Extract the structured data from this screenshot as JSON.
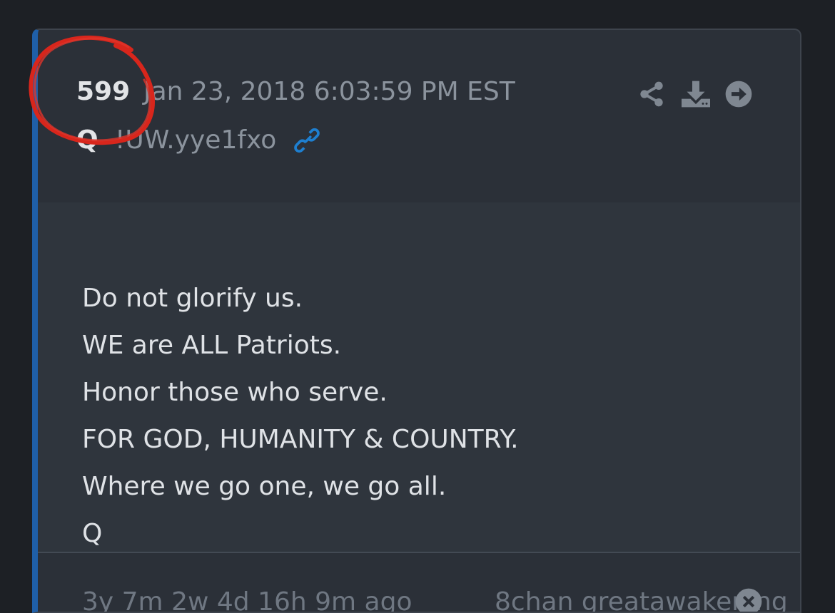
{
  "post": {
    "number": "599",
    "timestamp": "Jan 23, 2018 6:03:59 PM EST",
    "author": "Q",
    "tripcode": "!UW.yye1fxo"
  },
  "icons": {
    "link": "link-icon",
    "share": "share-icon",
    "download": "download-icon",
    "goto": "arrow-right-circle-icon"
  },
  "message": {
    "lines": [
      "Do not glorify us.",
      "WE are ALL Patriots.",
      "Honor those who serve.",
      "FOR GOD, HUMANITY & COUNTRY.",
      "Where we go one, we go all.",
      "Q"
    ]
  },
  "footer": {
    "age": "3y 7m 2w 4d 16h 9m ago",
    "source": "8chan greatawakening"
  },
  "colors": {
    "accent": "#1f5fa8",
    "link": "#1e7fd0",
    "annotation": "#d8261c"
  }
}
